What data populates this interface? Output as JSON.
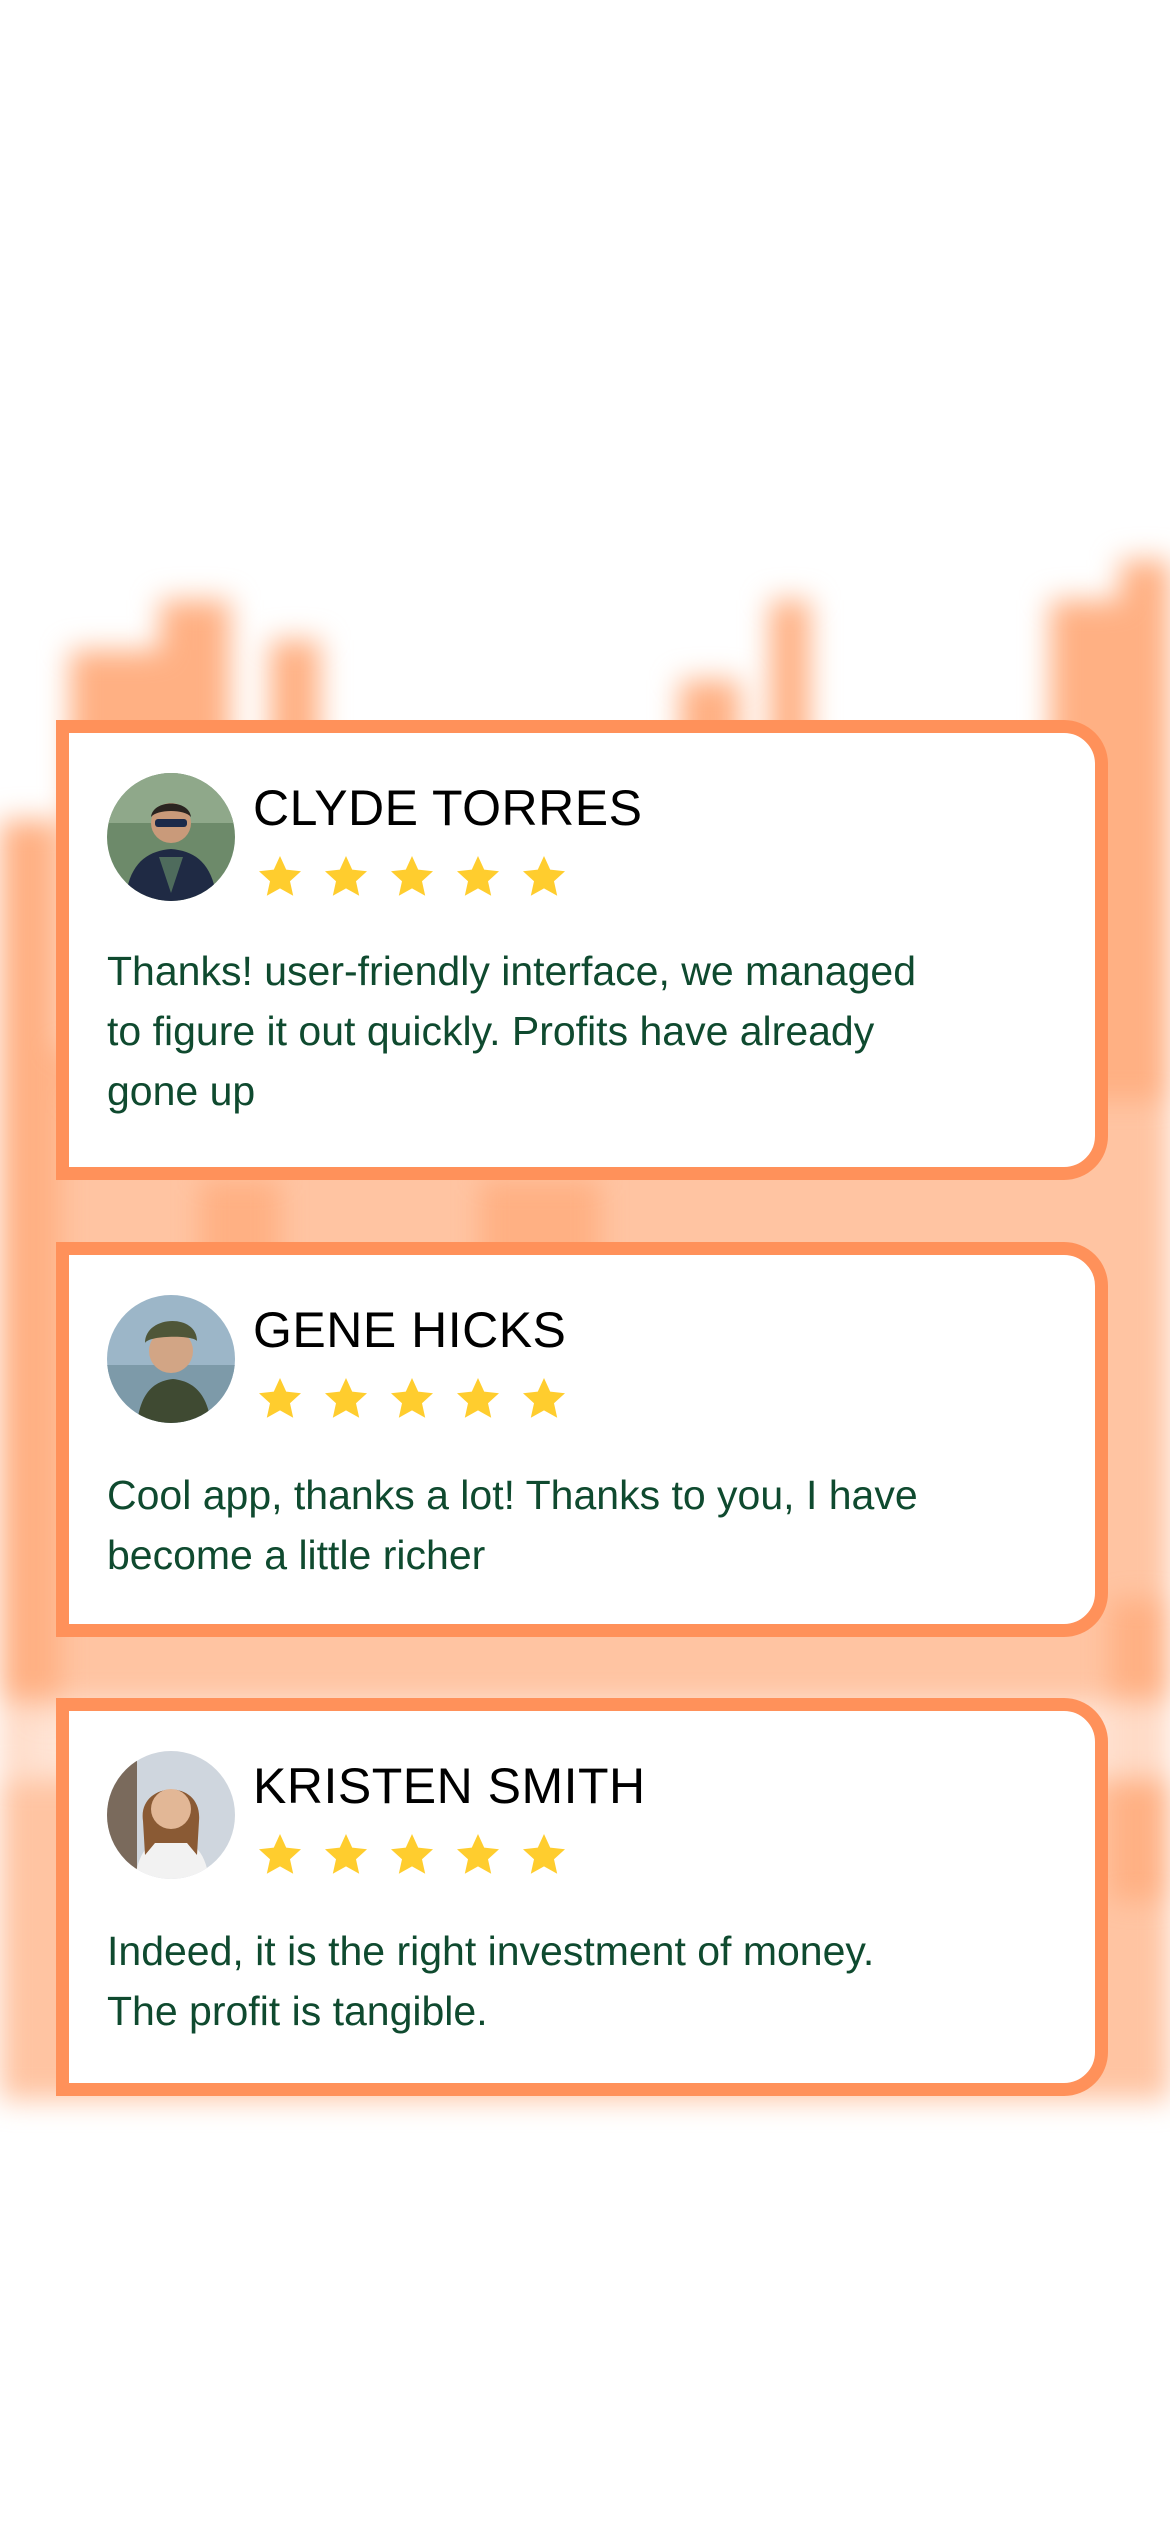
{
  "colors": {
    "accent": "#ff915a",
    "star": "#ffcd2e",
    "review_text": "#0f4a2f",
    "name_text": "#000000",
    "background_chart": "#ffb083"
  },
  "reviews": [
    {
      "name": "CLYDE TORRES",
      "rating": 5,
      "text": "Thanks! user-friendly interface, we managed to figure it out quickly. Profits have already gone up",
      "avatar_icon": "avatar-photo-man-sunglasses"
    },
    {
      "name": "GENE HICKS",
      "rating": 5,
      "text": "Cool app, thanks a lot! Thanks to you, I have become a little richer",
      "avatar_icon": "avatar-photo-man-beanie"
    },
    {
      "name": "KRISTEN SMITH",
      "rating": 5,
      "text": "Indeed, it is the right investment of money. The profit is tangible.",
      "avatar_icon": "avatar-photo-woman"
    }
  ]
}
